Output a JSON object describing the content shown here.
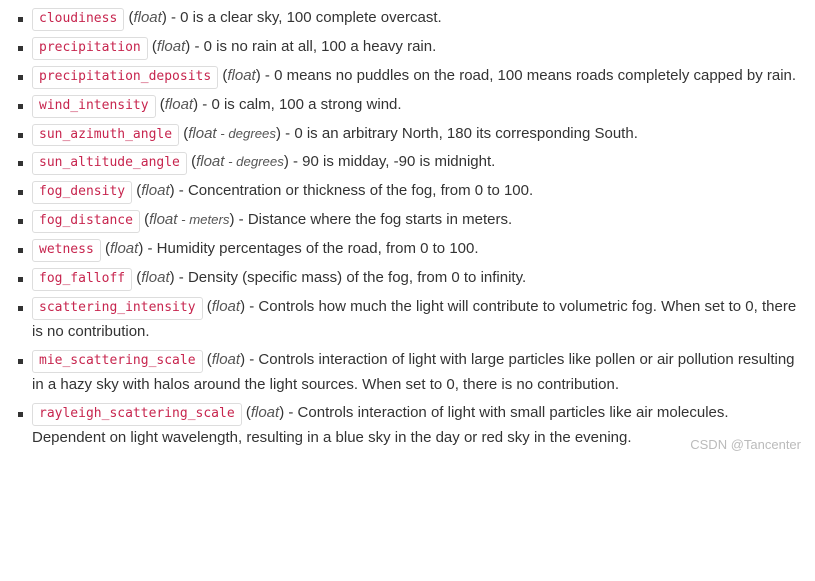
{
  "params": [
    {
      "name": "cloudiness",
      "type": "float",
      "unit": "",
      "desc": "0 is a clear sky, 100 complete overcast."
    },
    {
      "name": "precipitation",
      "type": "float",
      "unit": "",
      "desc": "0 is no rain at all, 100 a heavy rain."
    },
    {
      "name": "precipitation_deposits",
      "type": "float",
      "unit": "",
      "desc": "0 means no puddles on the road, 100 means roads completely capped by rain."
    },
    {
      "name": "wind_intensity",
      "type": "float",
      "unit": "",
      "desc": "0 is calm, 100 a strong wind."
    },
    {
      "name": "sun_azimuth_angle",
      "type": "float",
      "unit": "degrees",
      "desc": "0 is an arbitrary North, 180 its corresponding South."
    },
    {
      "name": "sun_altitude_angle",
      "type": "float",
      "unit": "degrees",
      "desc": "90 is midday, -90 is midnight."
    },
    {
      "name": "fog_density",
      "type": "float",
      "unit": "",
      "desc": "Concentration or thickness of the fog, from 0 to 100."
    },
    {
      "name": "fog_distance",
      "type": "float",
      "unit": "meters",
      "desc": "Distance where the fog starts in meters."
    },
    {
      "name": "wetness",
      "type": "float",
      "unit": "",
      "desc": "Humidity percentages of the road, from 0 to 100."
    },
    {
      "name": "fog_falloff",
      "type": "float",
      "unit": "",
      "desc": "Density (specific mass) of the fog, from 0 to infinity."
    },
    {
      "name": "scattering_intensity",
      "type": "float",
      "unit": "",
      "desc": "Controls how much the light will contribute to volumetric fog. When set to 0, there is no contribution."
    },
    {
      "name": "mie_scattering_scale",
      "type": "float",
      "unit": "",
      "desc": "Controls interaction of light with large particles like pollen or air pollution resulting in a hazy sky with halos around the light sources. When set to 0, there is no contribution."
    },
    {
      "name": "rayleigh_scattering_scale",
      "type": "float",
      "unit": "",
      "desc": "Controls interaction of light with small particles like air molecules. Dependent on light wavelength, resulting in a blue sky in the day or red sky in the evening."
    }
  ],
  "watermark": "CSDN @Tancenter"
}
